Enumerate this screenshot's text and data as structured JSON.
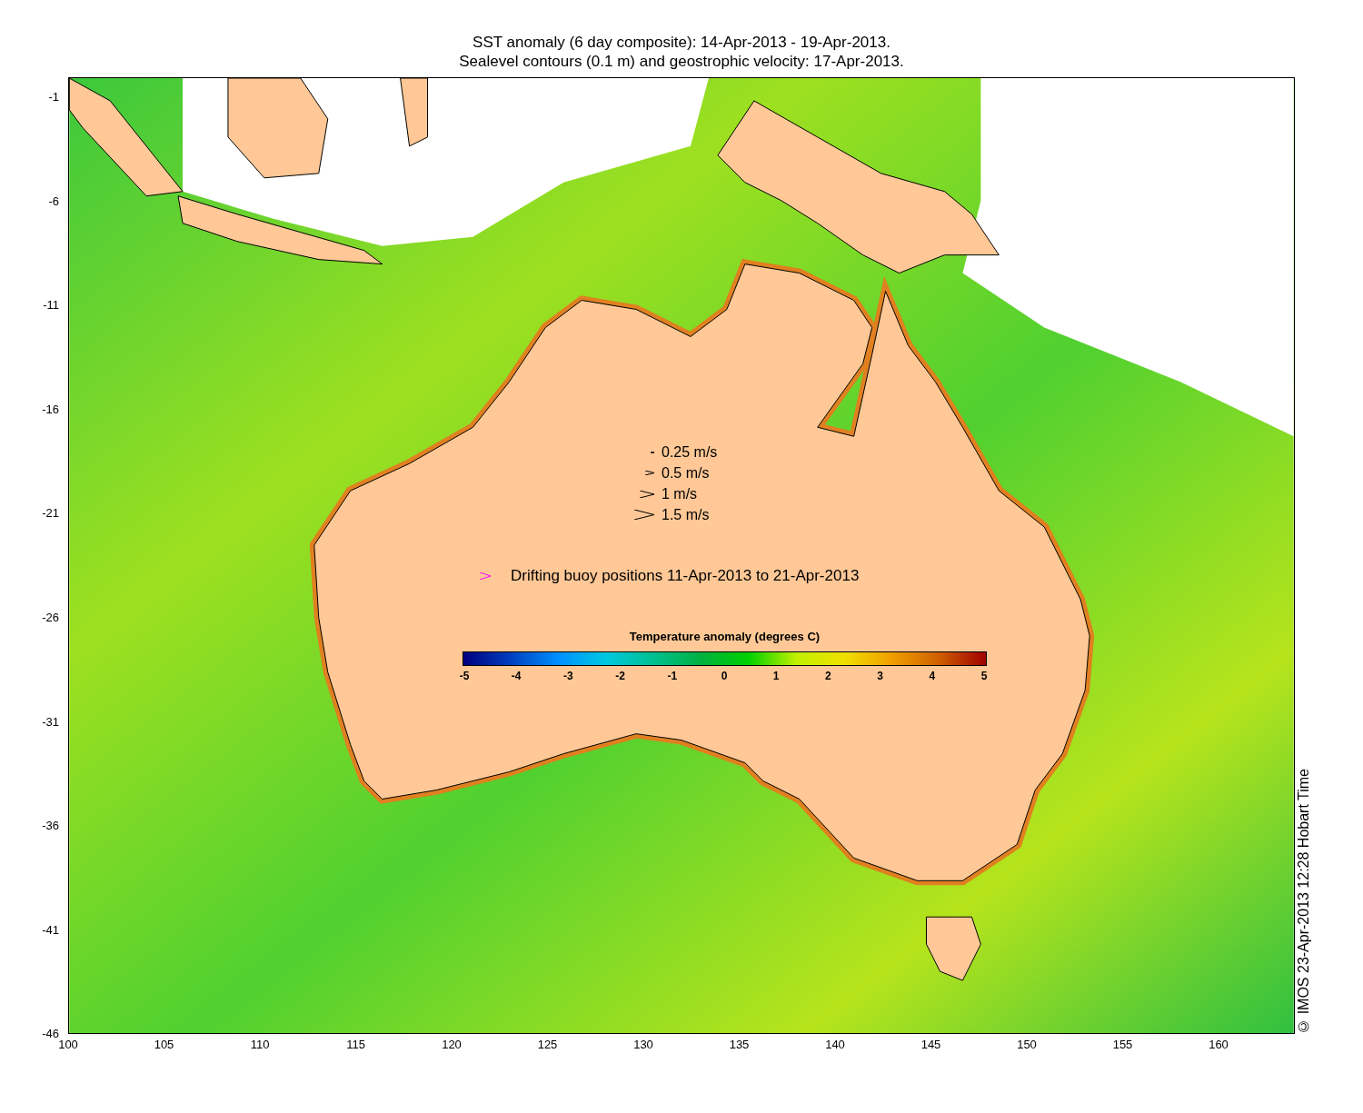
{
  "title": [
    "SST anomaly (6 day composite): 14-Apr-2013 - 19-Apr-2013.",
    "Sealevel contours (0.1 m) and geostrophic velocity: 17-Apr-2013."
  ],
  "map": {
    "y_ticks": [
      "-1",
      "-6",
      "-11",
      "-16",
      "-21",
      "-26",
      "-31",
      "-36",
      "-41",
      "-46"
    ],
    "x_ticks": [
      "100",
      "105",
      "110",
      "115",
      "120",
      "125",
      "130",
      "135",
      "140",
      "145",
      "150",
      "155",
      "160"
    ],
    "velocity_legend": [
      "0.25 m/s",
      "0.5 m/s",
      "1 m/s",
      "1.5 m/s"
    ],
    "buoy_legend": "Drifting buoy positions 11-Apr-2013 to 21-Apr-2013",
    "colorbar": {
      "title": "Temperature anomaly (degrees C)",
      "ticks": [
        "-5",
        "-4",
        "-3",
        "-2",
        "-1",
        "0",
        "1",
        "2",
        "3",
        "4",
        "5"
      ]
    }
  },
  "credit": "© IMOS 23-Apr-2013 12:28 Hobart Time"
}
